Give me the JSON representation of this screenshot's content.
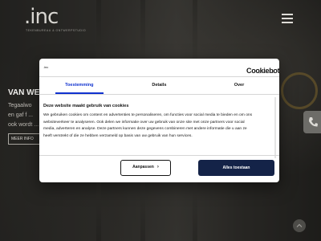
{
  "site": {
    "logo": ".inc",
    "logo_tagline": "TEKENBUREAU & ONTWERPSTUDIO",
    "hero_title": "VAN WEI...",
    "hero_lines": [
      "Tegaalwo",
      "en gaf f ...",
      "ook wordt ..."
    ],
    "hero_button": "MEER INFO"
  },
  "cookie_dialog": {
    "powered_by": ".inc",
    "brand": "Cookiebot",
    "brand_by": "by Usercentrics",
    "tabs": [
      {
        "label": "Toestemming",
        "active": true
      },
      {
        "label": "Details",
        "active": false
      },
      {
        "label": "Over",
        "active": false
      }
    ],
    "heading": "Deze website maakt gebruik van cookies",
    "body_lines": [
      "We gebruiken cookies om content en advertenties te personaliseren, om functies voor social media te bieden en om ons",
      "websiteverkeer te analyseren. Ook delen we informatie over uw gebruik van onze site met onze partners voor social",
      "media, adverteren en analyse. Deze partners kunnen deze gegevens combineren met andere informatie die u aan ze",
      "heeft verstrekt of die ze hebben verzameld op basis van uw gebruik van hun services."
    ],
    "customize_label": "Aanpassen",
    "allow_all_label": "Alles toestaan"
  },
  "colors": {
    "accent": "#1032cf",
    "primary_button": "#142348"
  },
  "icons": [
    "hamburger-menu-icon",
    "phone-icon",
    "chevron-right-icon",
    "arrow-up-icon"
  ]
}
